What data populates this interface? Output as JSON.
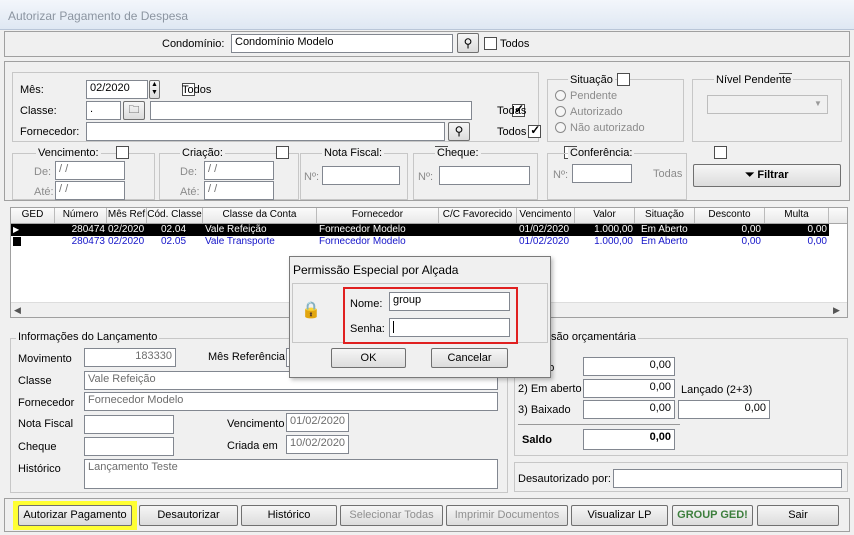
{
  "window": {
    "title": "Autorizar Pagamento de Despesa"
  },
  "condominio": {
    "label": "Condomínio:",
    "value": "Condomínio Modelo",
    "todos_label": "Todos"
  },
  "filters": {
    "mes_label": "Mês:",
    "mes_value": "02/2020",
    "mes_todos": "Todos",
    "classe_label": "Classe:",
    "classe_code": ".",
    "classe_todas": "Todas",
    "fornecedor_label": "Fornecedor:",
    "fornecedor_todos": "Todos",
    "situacao": {
      "title": "Situação",
      "options": [
        "Pendente",
        "Autorizado",
        "Não autorizado"
      ]
    },
    "nivel_pendente": {
      "title": "Nível Pendente"
    },
    "vencimento": {
      "title": "Vencimento:",
      "de_label": "De:",
      "ate_label": "Até:",
      "de_value": "/ /",
      "ate_value": "/ /"
    },
    "criacao": {
      "title": "Criação:",
      "de_label": "De:",
      "ate_label": "Até:",
      "de_value": "/ /",
      "ate_value": "/ /"
    },
    "nota_fiscal": {
      "title": "Nota Fiscal:",
      "num_label": "Nº:"
    },
    "cheque": {
      "title": "Cheque:",
      "num_label": "Nº:"
    },
    "conferencia": {
      "title": "Conferência:",
      "num_label": "Nº:",
      "todas_label": "Todas"
    },
    "filtrar_label": "Filtrar"
  },
  "grid": {
    "columns": [
      "GED",
      "Número",
      "Mês Ref",
      "Cód. Classe",
      "Classe da Conta",
      "Fornecedor",
      "C/C Favorecido",
      "Vencimento",
      "Valor",
      "Situação",
      "Desconto",
      "Multa"
    ],
    "rows": [
      [
        "",
        "280474",
        "02/2020",
        "02.04",
        "Vale Refeição",
        "Fornecedor Modelo",
        "",
        "01/02/2020",
        "1.000,00",
        "Em Aberto",
        "0,00",
        "0,00"
      ],
      [
        "",
        "280473",
        "02/2020",
        "02.05",
        "Vale Transporte",
        "Fornecedor Modelo",
        "",
        "01/02/2020",
        "1.000,00",
        "Em Aberto",
        "0,00",
        "0,00"
      ]
    ]
  },
  "lancamento": {
    "title": "Informações do Lançamento",
    "movimento_label": "Movimento",
    "movimento_value": "183330",
    "mes_ref_label": "Mês Referência",
    "classe_label": "Classe",
    "classe_value": "Vale Refeição",
    "fornecedor_label": "Fornecedor",
    "fornecedor_value": "Fornecedor Modelo",
    "nota_label": "Nota Fiscal",
    "vencimento_label": "Vencimento",
    "vencimento_value": "01/02/2020",
    "cheque_label": "Cheque",
    "criada_label": "Criada em",
    "criada_value": "10/02/2020",
    "historico_label": "Histórico",
    "historico_value": "Lançamento Teste"
  },
  "previsao": {
    "title": "evisão orçamentária",
    "row1_label": "ado",
    "row1_value": "0,00",
    "row2_label": "2) Em aberto",
    "row2_value": "0,00",
    "lancado_label": "Lançado (2+3)",
    "row3_label": "3) Baixado",
    "row3_value": "0,00",
    "row3_extra": "0,00",
    "saldo_label": "Saldo",
    "saldo_value": "0,00",
    "desautorizado_label": "Desautorizado por:"
  },
  "dialog": {
    "title": "Permissão Especial por Alçada",
    "nome_label": "Nome:",
    "nome_value": "group",
    "senha_label": "Senha:",
    "ok_label": "OK",
    "cancel_label": "Cancelar"
  },
  "buttons": {
    "autorizar": "Autorizar Pagamento",
    "desautorizar": "Desautorizar",
    "historico": "Histórico",
    "selecionar": "Selecionar Todas",
    "imprimir": "Imprimir Documentos",
    "visualizar": "Visualizar LP",
    "ged": "GROUP GED!",
    "sair": "Sair"
  },
  "colors": {
    "highlight": "#ffff33",
    "selected_row": "#000000",
    "dialog_box_outline": "#e02020",
    "row_text": "#1515c9"
  }
}
